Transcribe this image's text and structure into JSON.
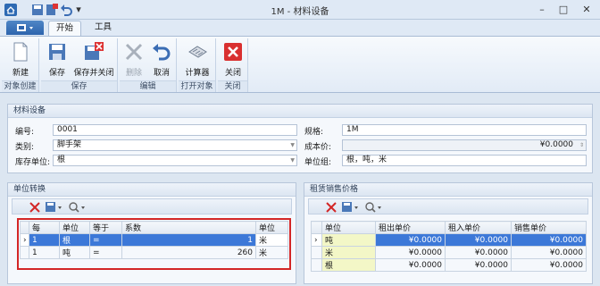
{
  "window": {
    "title": "1M - 材料设备",
    "minimize": "–",
    "maximize": "□",
    "close": "✕"
  },
  "ribbon": {
    "tabs": [
      "开始",
      "工具"
    ],
    "groups": [
      {
        "label": "对象创建",
        "buttons": [
          {
            "label": "新建",
            "icon": "new-document-icon"
          }
        ]
      },
      {
        "label": "保存",
        "buttons": [
          {
            "label": "保存",
            "icon": "save-icon"
          },
          {
            "label": "保存并关闭",
            "icon": "save-close-icon"
          }
        ]
      },
      {
        "label": "编辑",
        "buttons": [
          {
            "label": "删除",
            "icon": "delete-icon",
            "disabled": true
          },
          {
            "label": "取消",
            "icon": "undo-icon"
          }
        ]
      },
      {
        "label": "打开对象",
        "buttons": [
          {
            "label": "计算器",
            "icon": "calculator-icon"
          }
        ]
      },
      {
        "label": "关闭",
        "buttons": [
          {
            "label": "关闭",
            "icon": "close-icon"
          }
        ]
      }
    ]
  },
  "form": {
    "title": "材料设备",
    "code_label": "编号:",
    "code_value": "0001",
    "category_label": "类别:",
    "category_value": "脚手架",
    "stock_unit_label": "库存单位:",
    "stock_unit_value": "根",
    "spec_label": "规格:",
    "spec_value": "1M",
    "cost_label": "成本价:",
    "cost_value": "¥0.0000",
    "unit_group_label": "单位组:",
    "unit_group_value": "根，吨，米"
  },
  "unit_conversion": {
    "title": "单位转换",
    "columns": [
      "每",
      "单位",
      "等于",
      "系数",
      "单位"
    ],
    "rows": [
      {
        "per": "1",
        "unit": "根",
        "equals": "=",
        "factor": "1",
        "target_unit": "米"
      },
      {
        "per": "1",
        "unit": "吨",
        "equals": "=",
        "factor": "260",
        "target_unit": "米"
      }
    ]
  },
  "rental_price": {
    "title": "租赁销售价格",
    "columns": [
      "单位",
      "租出单价",
      "租入单价",
      "销售单价"
    ],
    "rows": [
      {
        "unit": "吨",
        "rent_out": "¥0.0000",
        "rent_in": "¥0.0000",
        "sale": "¥0.0000"
      },
      {
        "unit": "米",
        "rent_out": "¥0.0000",
        "rent_in": "¥0.0000",
        "sale": "¥0.0000"
      },
      {
        "unit": "根",
        "rent_out": "¥0.0000",
        "rent_in": "¥0.0000",
        "sale": "¥0.0000"
      }
    ]
  },
  "colors": {
    "accent": "#3c78d8",
    "highlight_box": "#d32626"
  }
}
